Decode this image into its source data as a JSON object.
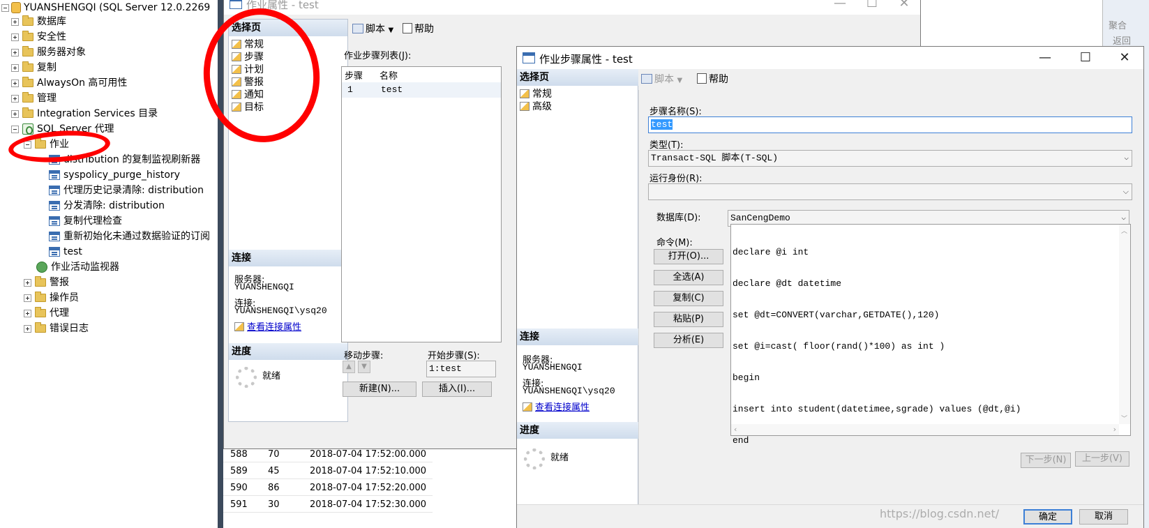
{
  "tree": {
    "root": "YUANSHENGQI (SQL Server 12.0.2269",
    "items": [
      "数据库",
      "安全性",
      "服务器对象",
      "复制",
      "AlwaysOn 高可用性",
      "管理",
      "Integration Services 目录",
      "SQL Server 代理"
    ],
    "jobs_folder": "作业",
    "jobs": [
      "distribution 的复制监视刷新器",
      "syspolicy_purge_history",
      "代理历史记录清除: distribution",
      "分发清除: distribution",
      "复制代理检查",
      "重新初始化未通过数据验证的订阅",
      "test"
    ],
    "monitor": "作业活动监视器",
    "after": [
      "警报",
      "操作员",
      "代理",
      "错误日志"
    ]
  },
  "job_window": {
    "title": "作业属性 - test",
    "select_page": "选择页",
    "pages": [
      "常规",
      "步骤",
      "计划",
      "警报",
      "通知",
      "目标"
    ],
    "toolbar": {
      "script": "脚本",
      "help": "帮助"
    },
    "steps_label": "作业步骤列表(J):",
    "cols": [
      "步骤",
      "名称"
    ],
    "rows": [
      {
        "step": "1",
        "name": "test"
      }
    ],
    "conn_header": "连接",
    "server_label": "服务器:",
    "server_value": "YUANSHENGQI",
    "conn_label": "连接:",
    "conn_value": "YUANSHENGQI\\ysq20",
    "view_conn": "查看连接属性",
    "progress_header": "进度",
    "progress_status": "就绪",
    "move_step": "移动步骤:",
    "start_step_label": "开始步骤(S):",
    "start_step_value": "1:test",
    "new_btn": "新建(N)...",
    "insert_btn": "插入(I)..."
  },
  "step_window": {
    "title": "作业步骤属性 - test",
    "select_page": "选择页",
    "pages": [
      "常规",
      "高级"
    ],
    "toolbar": {
      "script": "脚本",
      "help": "帮助"
    },
    "step_name_label": "步骤名称(S):",
    "step_name_value": "test",
    "type_label": "类型(T):",
    "type_value": "Transact-SQL 脚本(T-SQL)",
    "runas_label": "运行身份(R):",
    "runas_value": "",
    "db_label": "数据库(D):",
    "db_value": "SanCengDemo",
    "cmd_label": "命令(M):",
    "cmd_lines": [
      "declare @i int",
      "declare @dt datetime",
      "set @dt=CONVERT(varchar,GETDATE(),120)",
      "set @i=cast( floor(rand()*100) as int )",
      "begin",
      "insert into student(datetimee,sgrade) values (@dt,@i)",
      "end"
    ],
    "buttons": {
      "open": "打开(O)...",
      "select_all": "全选(A)",
      "copy": "复制(C)",
      "paste": "粘贴(P)",
      "parse": "分析(E)"
    },
    "conn_header": "连接",
    "server_label": "服务器:",
    "server_value": "YUANSHENGQI",
    "conn_label": "连接:",
    "conn_value": "YUANSHENGQI\\ysq20",
    "view_conn": "查看连接属性",
    "progress_header": "进度",
    "progress_status": "就绪",
    "next_btn": "下一步(N)",
    "prev_btn": "上一步(V)",
    "ok_btn": "确定",
    "cancel_btn": "取消"
  },
  "results": [
    {
      "id": "588",
      "grade": "70",
      "time": "2018-07-04 17:52:00.000"
    },
    {
      "id": "589",
      "grade": "45",
      "time": "2018-07-04 17:52:10.000"
    },
    {
      "id": "590",
      "grade": "86",
      "time": "2018-07-04 17:52:20.000"
    },
    {
      "id": "591",
      "grade": "30",
      "time": "2018-07-04 17:52:30.000"
    }
  ],
  "right_panel": {
    "item1": "聚合",
    "item2": "返回"
  },
  "watermark": "https://blog.csdn.net/"
}
